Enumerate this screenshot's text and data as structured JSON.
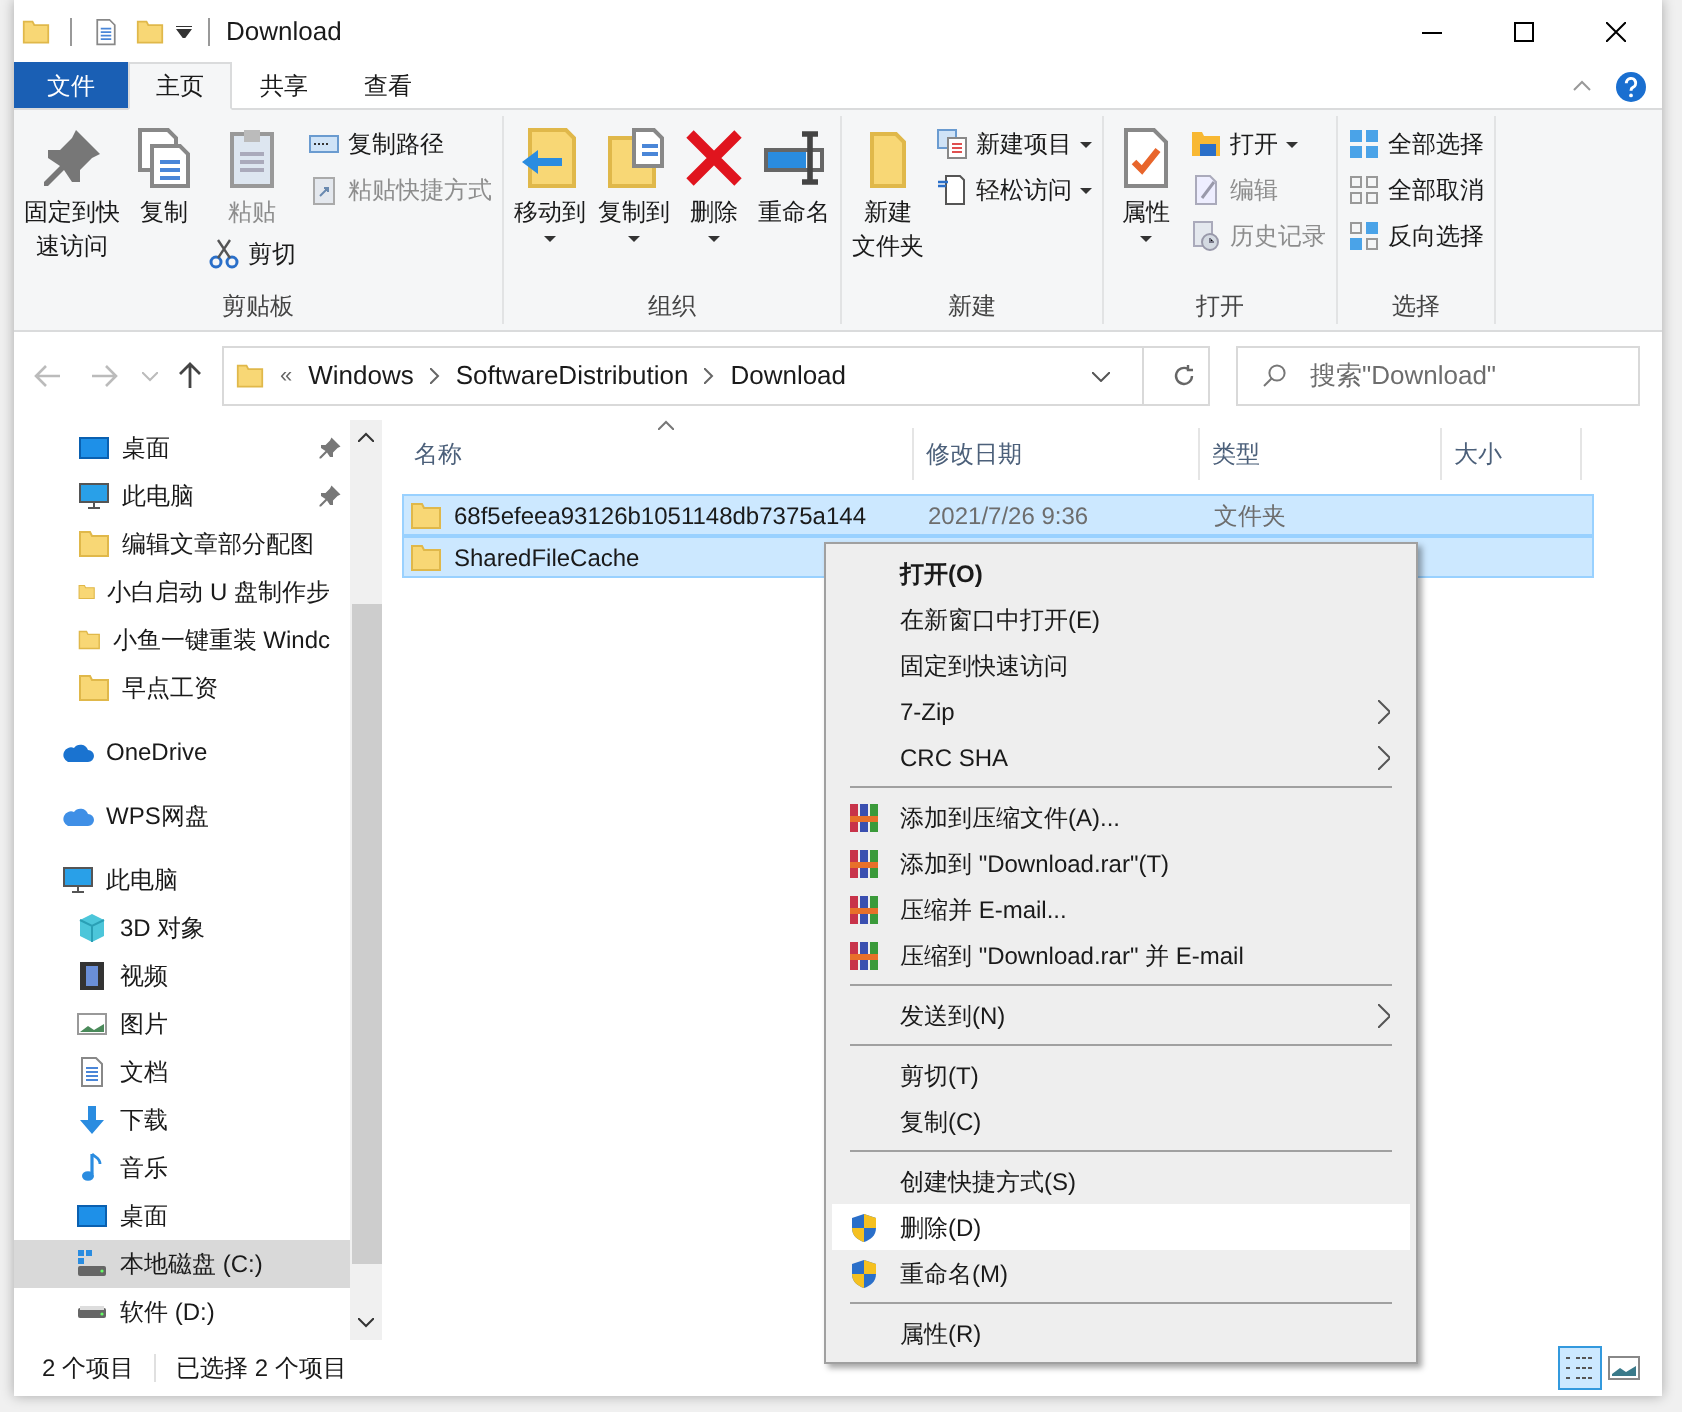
{
  "window": {
    "title": "Download"
  },
  "tabs": [
    {
      "label": "文件",
      "kind": "file",
      "selected": false
    },
    {
      "label": "主页",
      "kind": "tab",
      "selected": true
    },
    {
      "label": "共享",
      "kind": "tab",
      "selected": false
    },
    {
      "label": "查看",
      "kind": "tab",
      "selected": false
    }
  ],
  "ribbon": {
    "groups": [
      {
        "label": "剪贴板",
        "columns": [
          [
            {
              "kind": "large",
              "lines": [
                "固定到快",
                "速访问"
              ],
              "disabled": false,
              "dropdown": false
            }
          ],
          [
            {
              "kind": "large",
              "lines": [
                "复制"
              ],
              "disabled": false,
              "dropdown": false
            }
          ],
          [
            {
              "kind": "large",
              "lines": [
                "粘贴"
              ],
              "disabled": true,
              "dropdown": false
            },
            {
              "kind": "small",
              "label": "剪切",
              "disabled": false,
              "dropdown": false
            }
          ],
          [
            {
              "kind": "small",
              "label": "复制路径",
              "disabled": false,
              "dropdown": false
            },
            {
              "kind": "small",
              "label": "粘贴快捷方式",
              "disabled": true,
              "dropdown": false
            }
          ]
        ]
      },
      {
        "label": "组织",
        "columns": [
          [
            {
              "kind": "large",
              "lines": [
                "移动到"
              ],
              "disabled": false,
              "dropdown": true
            }
          ],
          [
            {
              "kind": "large",
              "lines": [
                "复制到"
              ],
              "disabled": false,
              "dropdown": true
            }
          ],
          [
            {
              "kind": "large",
              "lines": [
                "删除"
              ],
              "disabled": false,
              "dropdown": true
            }
          ],
          [
            {
              "kind": "large",
              "lines": [
                "重命名"
              ],
              "disabled": false,
              "dropdown": false
            }
          ]
        ]
      },
      {
        "label": "新建",
        "columns": [
          [
            {
              "kind": "large",
              "lines": [
                "新建",
                "文件夹"
              ],
              "disabled": false,
              "dropdown": false
            }
          ],
          [
            {
              "kind": "small",
              "label": "新建项目",
              "disabled": false,
              "dropdown": true
            },
            {
              "kind": "small",
              "label": "轻松访问",
              "disabled": false,
              "dropdown": true
            }
          ]
        ]
      },
      {
        "label": "打开",
        "columns": [
          [
            {
              "kind": "large",
              "lines": [
                "属性"
              ],
              "disabled": false,
              "dropdown": true
            }
          ],
          [
            {
              "kind": "small",
              "label": "打开",
              "disabled": false,
              "dropdown": true
            },
            {
              "kind": "small",
              "label": "编辑",
              "disabled": true,
              "dropdown": false
            },
            {
              "kind": "small",
              "label": "历史记录",
              "disabled": true,
              "dropdown": false
            }
          ]
        ]
      },
      {
        "label": "选择",
        "columns": [
          [
            {
              "kind": "small",
              "label": "全部选择",
              "disabled": false,
              "dropdown": false
            },
            {
              "kind": "small",
              "label": "全部取消",
              "disabled": false,
              "dropdown": false
            },
            {
              "kind": "small",
              "label": "反向选择",
              "disabled": false,
              "dropdown": false
            }
          ]
        ]
      }
    ]
  },
  "address": {
    "overflow": "«",
    "crumbs": [
      "Windows",
      "SoftwareDistribution",
      "Download"
    ]
  },
  "search": {
    "placeholder": "搜索\"Download\""
  },
  "sidebar": {
    "sections": [
      {
        "items": [
          {
            "label": "桌面",
            "pinned": true,
            "selected": false
          },
          {
            "label": "此电脑",
            "pinned": true,
            "selected": false
          },
          {
            "label": "编辑文章部分配图",
            "pinned": false,
            "selected": false
          },
          {
            "label": "小白启动 U 盘制作步",
            "pinned": false,
            "selected": false
          },
          {
            "label": "小鱼一键重装 Windc",
            "pinned": false,
            "selected": false
          },
          {
            "label": "早点工资",
            "pinned": false,
            "selected": false
          }
        ]
      },
      {
        "items": [
          {
            "label": "OneDrive",
            "pinned": false,
            "selected": false
          }
        ]
      },
      {
        "items": [
          {
            "label": "WPS网盘",
            "pinned": false,
            "selected": false
          }
        ]
      },
      {
        "items": [
          {
            "label": "此电脑",
            "pinned": false,
            "selected": false,
            "children": [
              {
                "label": "3D 对象",
                "selected": false
              },
              {
                "label": "视频",
                "selected": false
              },
              {
                "label": "图片",
                "selected": false
              },
              {
                "label": "文档",
                "selected": false
              },
              {
                "label": "下载",
                "selected": false
              },
              {
                "label": "音乐",
                "selected": false
              },
              {
                "label": "桌面",
                "selected": false
              },
              {
                "label": "本地磁盘 (C:)",
                "selected": true
              },
              {
                "label": "软件 (D:)",
                "selected": false
              }
            ]
          }
        ]
      }
    ]
  },
  "table": {
    "columns": [
      "名称",
      "修改日期",
      "类型",
      "大小"
    ],
    "rows": [
      {
        "name": "68f5efeea93126b1051148db7375a144",
        "date": "2021/7/26 9:36",
        "type": "文件夹",
        "selected": true
      },
      {
        "name": "SharedFileCache",
        "selected": true
      }
    ]
  },
  "context_menu": {
    "items": [
      {
        "kind": "item",
        "label": "打开(O)",
        "bold": true,
        "submenu": false,
        "highlighted": false
      },
      {
        "kind": "item",
        "label": "在新窗口中打开(E)",
        "bold": false,
        "submenu": false,
        "highlighted": false
      },
      {
        "kind": "item",
        "label": "固定到快速访问",
        "bold": false,
        "submenu": false,
        "highlighted": false
      },
      {
        "kind": "item",
        "label": "7-Zip",
        "bold": false,
        "submenu": true,
        "highlighted": false
      },
      {
        "kind": "item",
        "label": "CRC SHA",
        "bold": false,
        "submenu": true,
        "highlighted": false
      },
      {
        "kind": "separator"
      },
      {
        "kind": "item",
        "label": "添加到压缩文件(A)...",
        "bold": false,
        "submenu": false,
        "highlighted": false
      },
      {
        "kind": "item",
        "label": "添加到 \"Download.rar\"(T)",
        "bold": false,
        "submenu": false,
        "highlighted": false
      },
      {
        "kind": "item",
        "label": "压缩并 E-mail...",
        "bold": false,
        "submenu": false,
        "highlighted": false
      },
      {
        "kind": "item",
        "label": "压缩到 \"Download.rar\" 并 E-mail",
        "bold": false,
        "submenu": false,
        "highlighted": false
      },
      {
        "kind": "separator"
      },
      {
        "kind": "item",
        "label": "发送到(N)",
        "bold": false,
        "submenu": true,
        "highlighted": false
      },
      {
        "kind": "separator"
      },
      {
        "kind": "item",
        "label": "剪切(T)",
        "bold": false,
        "submenu": false,
        "highlighted": false
      },
      {
        "kind": "item",
        "label": "复制(C)",
        "bold": false,
        "submenu": false,
        "highlighted": false
      },
      {
        "kind": "separator"
      },
      {
        "kind": "item",
        "label": "创建快捷方式(S)",
        "bold": false,
        "submenu": false,
        "highlighted": false
      },
      {
        "kind": "item",
        "label": "删除(D)",
        "bold": false,
        "submenu": false,
        "highlighted": true
      },
      {
        "kind": "item",
        "label": "重命名(M)",
        "bold": false,
        "submenu": false,
        "highlighted": false
      },
      {
        "kind": "separator"
      },
      {
        "kind": "item",
        "label": "属性(R)",
        "bold": false,
        "submenu": false,
        "highlighted": false
      }
    ]
  },
  "status_bar": {
    "items": [
      "2 个项目",
      "已选择 2 个项目"
    ],
    "views": [
      {
        "kind": "details",
        "selected": true
      },
      {
        "kind": "tiles",
        "selected": false
      }
    ]
  }
}
